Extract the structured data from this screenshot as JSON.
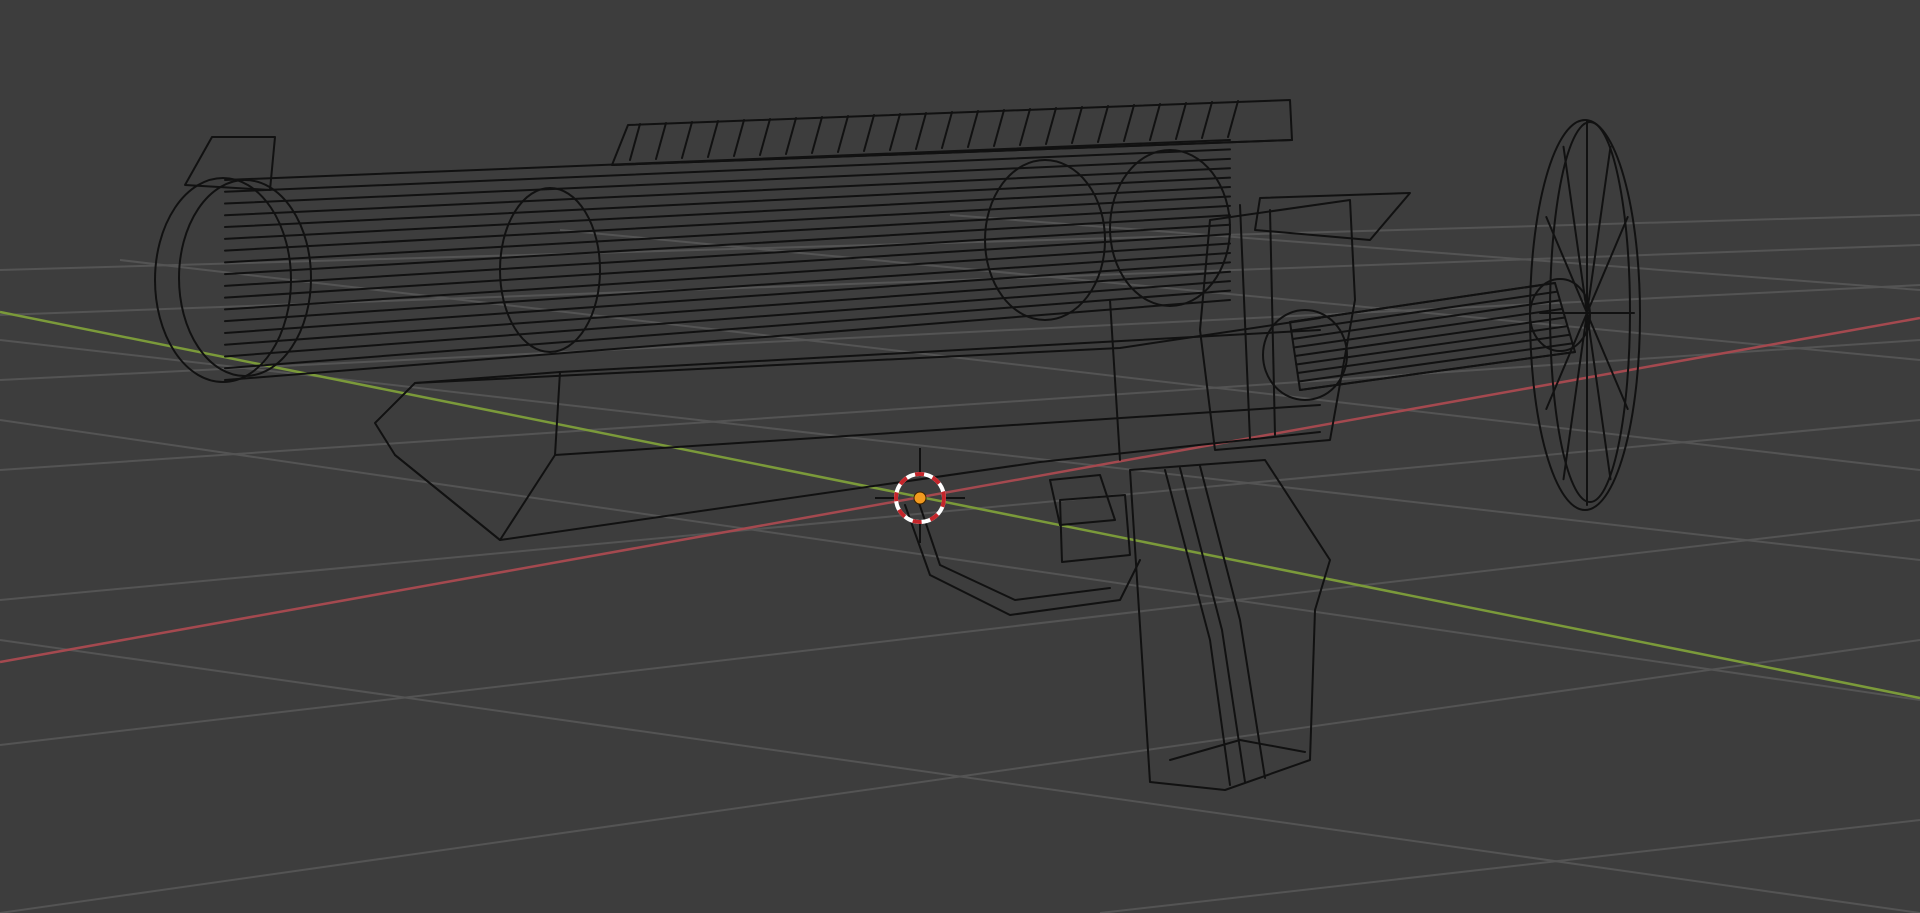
{
  "viewport": {
    "mode": "wireframe",
    "background_color": "#3d3d3d",
    "grid_color": "#545454",
    "x_axis_color": "#a4494f",
    "y_axis_color": "#7b9a3a",
    "wire_color": "#111111",
    "origin_color": "#f29a1f",
    "cursor_colors": [
      "#c4262b",
      "#ffffff"
    ]
  },
  "scene": {
    "object": "launcher-model",
    "icons": [
      "3d-cursor-icon",
      "origin-point-icon"
    ]
  }
}
